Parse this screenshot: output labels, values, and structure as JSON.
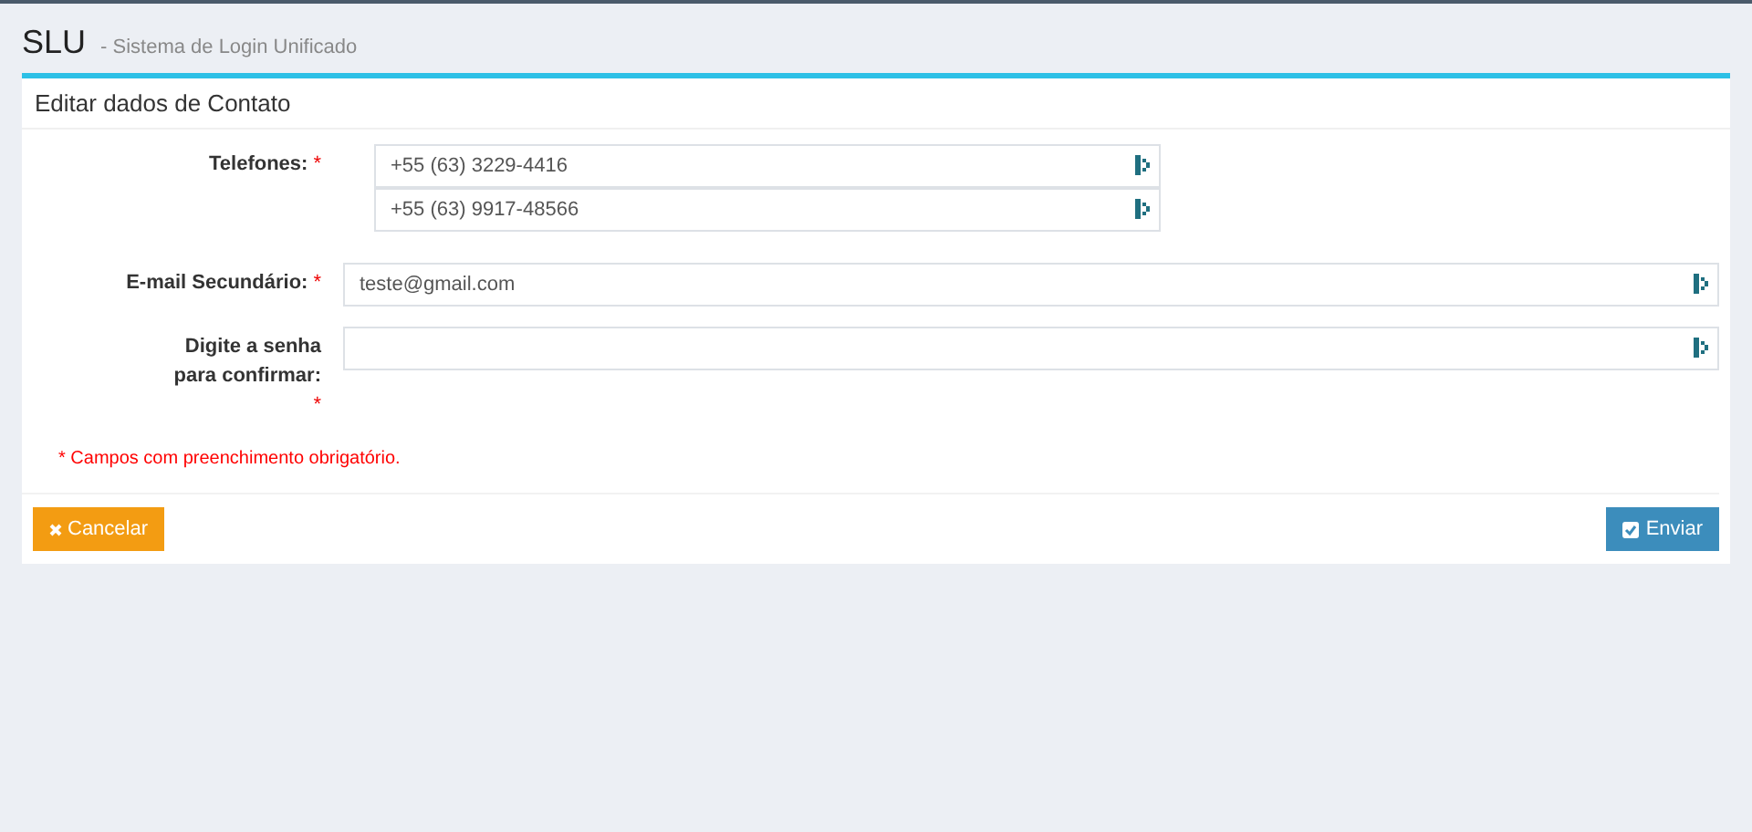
{
  "header": {
    "title": "SLU",
    "subtitle": "- Sistema de Login Unificado"
  },
  "card": {
    "title": "Editar dados de Contato"
  },
  "fields": [
    {
      "kind": "phones",
      "label": "Telefones:",
      "required_mark": "*",
      "values": [
        "+55 (63) 3229-4416",
        "+55 (63) 9917-48566"
      ]
    },
    {
      "kind": "text",
      "label": "E-mail Secundário:",
      "required_mark": "*",
      "value": "teste@gmail.com"
    },
    {
      "kind": "password",
      "label": "Digite a senha para confirmar:",
      "required_mark": "*"
    }
  ],
  "note": "* Campos com preenchimento obrigatório.",
  "buttons": {
    "cancel": "Cancelar",
    "submit": "Enviar"
  }
}
